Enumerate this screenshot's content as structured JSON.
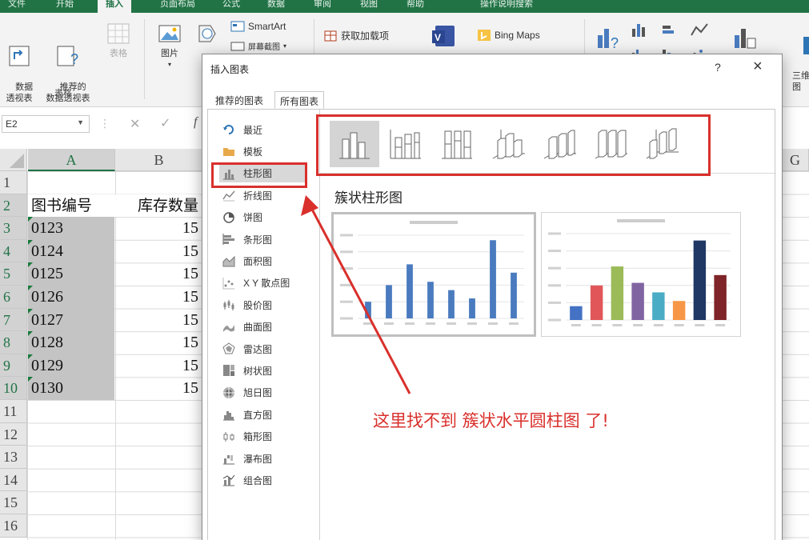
{
  "ribbon_tabs": [
    "文件",
    "开始",
    "插入",
    "页面布局",
    "公式",
    "数据",
    "审阅",
    "视图",
    "帮助",
    "操作说明搜索"
  ],
  "ribbon": {
    "pivot_table": "数据\n透视表",
    "recommended_pivot": "推荐的\n数据透视表",
    "table": "表格",
    "group_table": "表格",
    "pictures": "图片",
    "smartart": "SmartArt",
    "screenshot": "屏幕截图",
    "get_addins": "获取加载项",
    "bing_maps": "Bing Maps",
    "three_d": "三维\n图"
  },
  "name_box": "E2",
  "columns": [
    "A",
    "B",
    "G"
  ],
  "rows": [
    "1",
    "2",
    "3",
    "4",
    "5",
    "6",
    "7",
    "8",
    "9",
    "10",
    "11",
    "12",
    "13",
    "14",
    "15",
    "16"
  ],
  "sheet": {
    "header_a": "图书编号",
    "header_b": "库存数量",
    "ids": [
      "0123",
      "0124",
      "0125",
      "0126",
      "0127",
      "0128",
      "0129",
      "0130"
    ],
    "qty_partial": [
      "15",
      "15",
      "15",
      "15",
      "15",
      "15",
      "15",
      "15"
    ]
  },
  "dialog": {
    "title": "插入图表",
    "help": "?",
    "close": "×",
    "tab_recommended": "推荐的图表",
    "tab_all": "所有图表",
    "categories": [
      {
        "label": "最近",
        "icon": "recent-icon"
      },
      {
        "label": "模板",
        "icon": "folder-icon"
      },
      {
        "label": "柱形图",
        "icon": "column-chart-icon"
      },
      {
        "label": "折线图",
        "icon": "line-chart-icon"
      },
      {
        "label": "饼图",
        "icon": "pie-chart-icon"
      },
      {
        "label": "条形图",
        "icon": "bar-chart-icon"
      },
      {
        "label": "面积图",
        "icon": "area-chart-icon"
      },
      {
        "label": "X Y 散点图",
        "icon": "scatter-chart-icon"
      },
      {
        "label": "股价图",
        "icon": "stock-chart-icon"
      },
      {
        "label": "曲面图",
        "icon": "surface-chart-icon"
      },
      {
        "label": "雷达图",
        "icon": "radar-chart-icon"
      },
      {
        "label": "树状图",
        "icon": "treemap-chart-icon"
      },
      {
        "label": "旭日图",
        "icon": "sunburst-chart-icon"
      },
      {
        "label": "直方图",
        "icon": "histogram-chart-icon"
      },
      {
        "label": "箱形图",
        "icon": "boxwhisker-chart-icon"
      },
      {
        "label": "瀑布图",
        "icon": "waterfall-chart-icon"
      },
      {
        "label": "组合图",
        "icon": "combo-chart-icon"
      }
    ],
    "selected_category": "柱形图",
    "subtype_title": "簇状柱形图",
    "preview1": {
      "values": [
        2,
        4,
        6.5,
        4.4,
        3.4,
        2.4,
        9.4,
        5.5
      ],
      "bar_color": "#4a7bbf"
    },
    "preview2": {
      "values": [
        1.6,
        4,
        6.2,
        4.3,
        3.2,
        2.2,
        9.2,
        5.2
      ],
      "bar_colors": [
        "#4472c4",
        "#e15759",
        "#9bbb59",
        "#8064a2",
        "#4bacc6",
        "#f79646",
        "#1f3864",
        "#7f2428"
      ]
    }
  },
  "annotation": "这里找不到 簇状水平圆柱图 了!",
  "colors": {
    "excel_green": "#217346",
    "annot_red": "#d9302c"
  }
}
